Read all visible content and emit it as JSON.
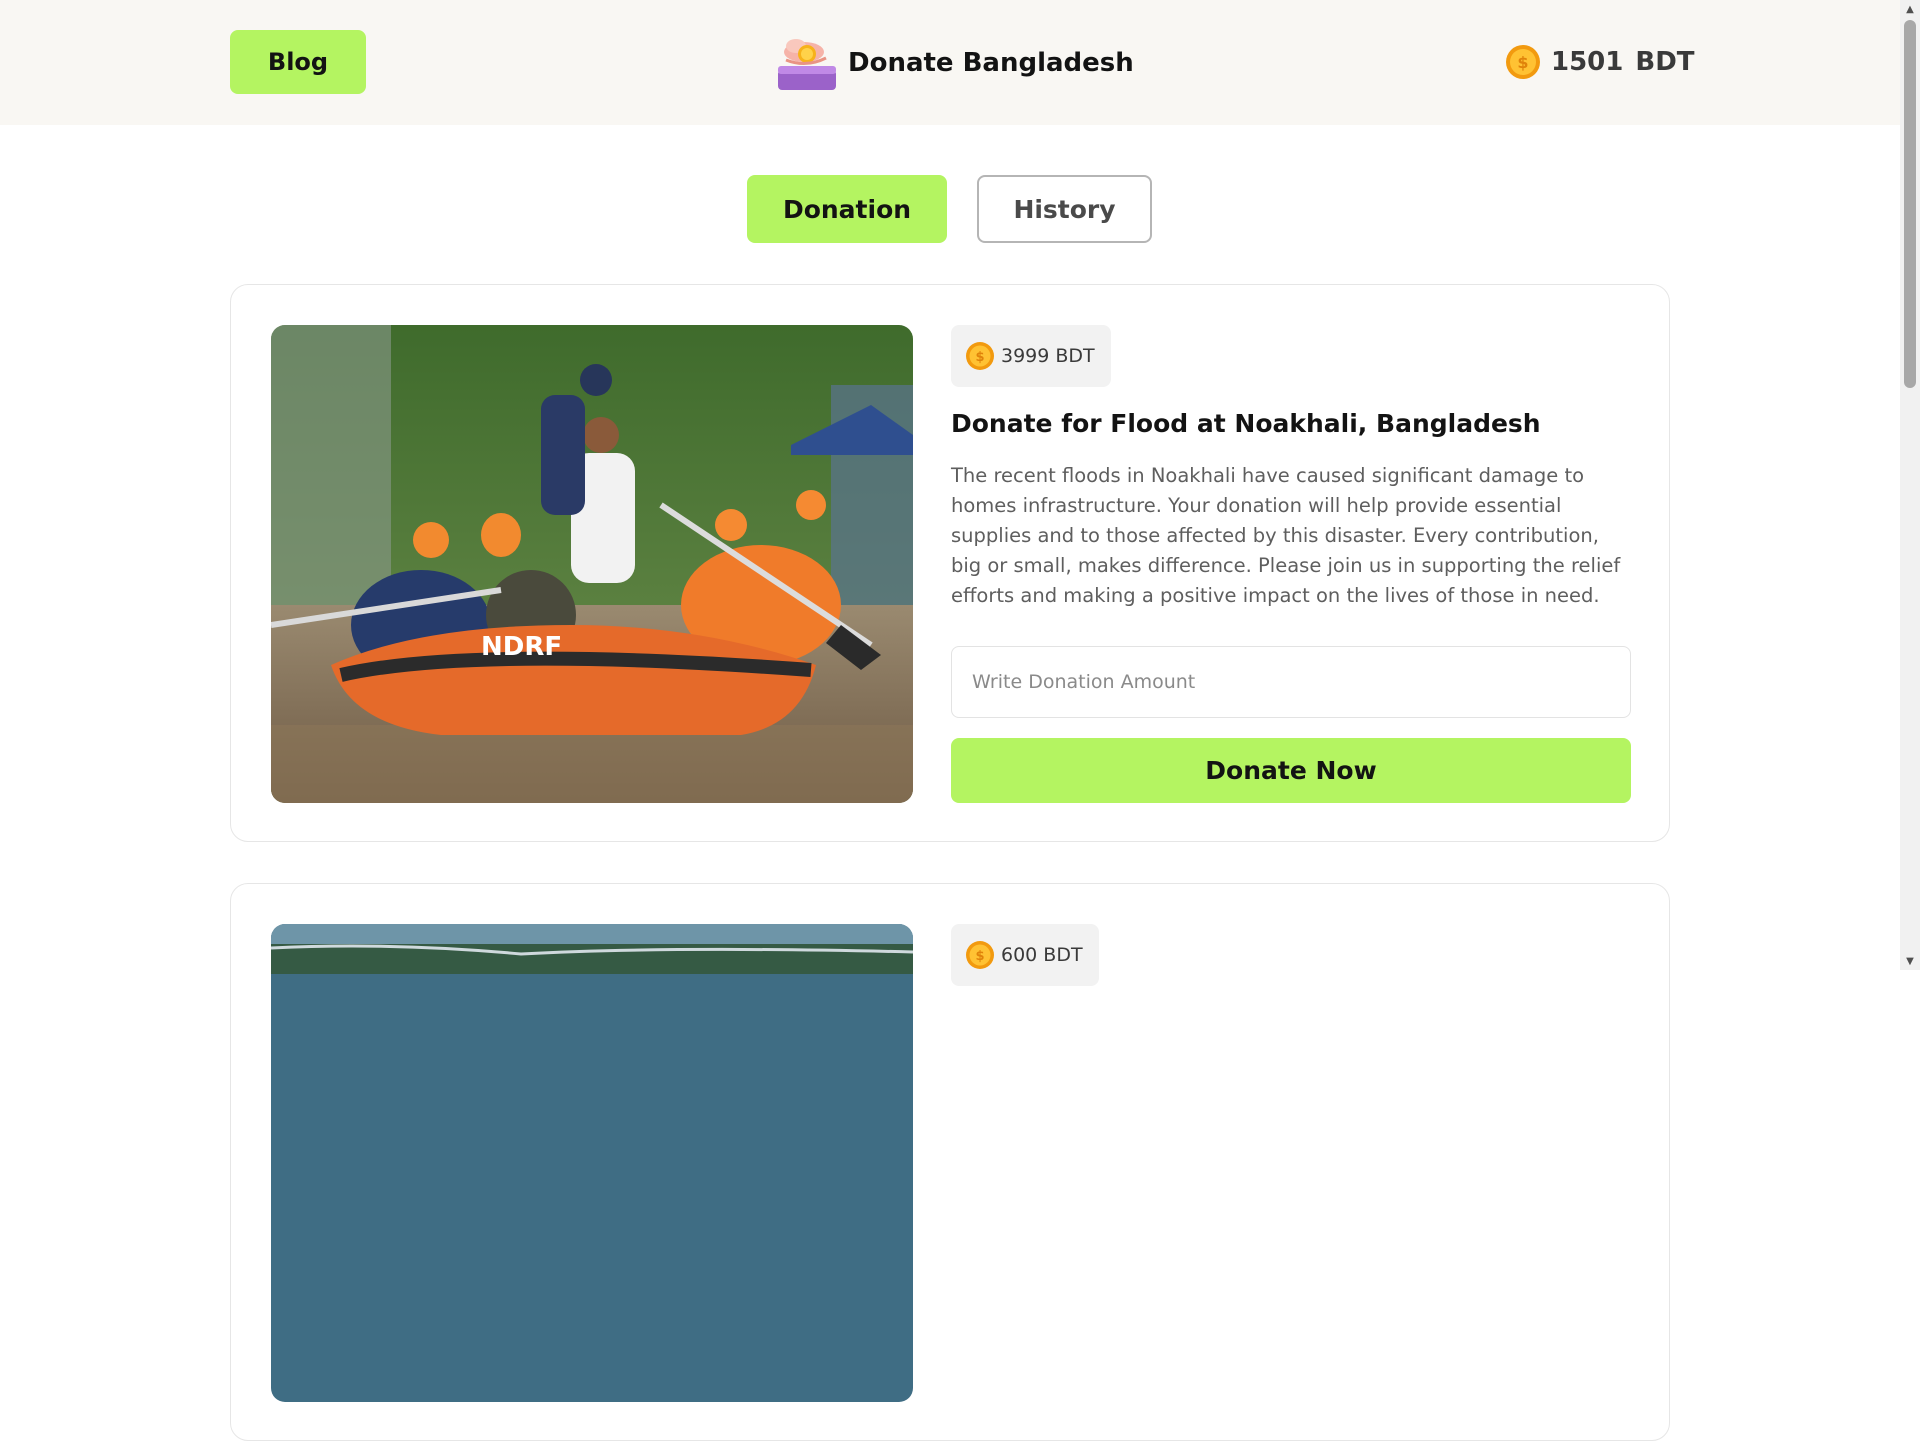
{
  "header": {
    "blog_label": "Blog",
    "brand_name": "Donate Bangladesh",
    "balance_amount": "1501",
    "balance_currency": "BDT"
  },
  "tabs": [
    {
      "label": "Donation",
      "active": true
    },
    {
      "label": "History",
      "active": false
    }
  ],
  "donations": [
    {
      "amount": "3999 BDT",
      "title": "Donate for Flood at Noakhali, Bangladesh",
      "description": "The recent floods in Noakhali have caused significant damage to homes infrastructure. Your donation will help provide essential supplies and to those affected by this disaster. Every contribution, big or small, makes difference. Please join us in supporting the relief efforts and making a positive impact on the lives of those in need.",
      "input_placeholder": "Write Donation Amount",
      "button_label": "Donate Now",
      "image": "flood-rescue-boat"
    },
    {
      "amount": "600 BDT",
      "image": "aerial-flood-landscape"
    }
  ],
  "icons": {
    "brand_logo": "donation-hand-coin-icon",
    "coin": "coin-icon"
  },
  "colors": {
    "accent": "#b4f461",
    "header_bg": "#f9f7f3",
    "text_primary": "#131313",
    "text_secondary": "#5e5e5e",
    "coin": "#f7b21a"
  }
}
